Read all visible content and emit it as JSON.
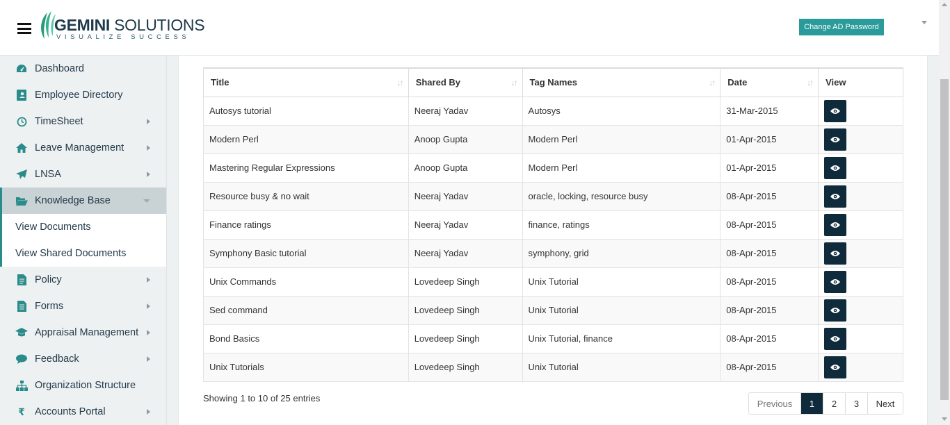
{
  "header": {
    "logo_main_light": "GEMINI",
    "logo_main_second": " SOLUTIONS",
    "logo_tagline": "VISUALIZE SUCCESS",
    "ad_button": "Change AD Password"
  },
  "sidebar": {
    "items": [
      {
        "label": "Dashboard",
        "icon": "dashboard-icon"
      },
      {
        "label": "Employee Directory",
        "icon": "contact-card-icon"
      },
      {
        "label": "TimeSheet",
        "icon": "clock-icon"
      },
      {
        "label": "Leave Management",
        "icon": "home-icon"
      },
      {
        "label": "LNSA",
        "icon": "paper-plane-icon"
      },
      {
        "label": "Knowledge Base",
        "icon": "folder-open-icon"
      },
      {
        "label": "Policy",
        "icon": "document-icon"
      },
      {
        "label": "Forms",
        "icon": "form-icon"
      },
      {
        "label": "Appraisal Management",
        "icon": "graduation-cap-icon"
      },
      {
        "label": "Feedback",
        "icon": "comments-icon"
      },
      {
        "label": "Organization Structure",
        "icon": "sitemap-icon"
      },
      {
        "label": "Accounts Portal",
        "icon": "rupee-icon"
      }
    ],
    "subitems": [
      {
        "label": "View Documents"
      },
      {
        "label": "View Shared Documents"
      }
    ]
  },
  "table": {
    "columns": [
      "Title",
      "Shared By",
      "Tag Names",
      "Date",
      "View"
    ],
    "rows": [
      [
        "Autosys tutorial",
        "Neeraj Yadav",
        "Autosys",
        "31-Mar-2015"
      ],
      [
        "Modern Perl",
        "Anoop Gupta",
        "Modern Perl",
        "01-Apr-2015"
      ],
      [
        "Mastering Regular Expressions",
        "Anoop Gupta",
        "Modern Perl",
        "01-Apr-2015"
      ],
      [
        "Resource busy & no wait",
        "Neeraj Yadav",
        "oracle, locking, resource busy",
        "08-Apr-2015"
      ],
      [
        "Finance ratings",
        "Neeraj Yadav",
        "finance, ratings",
        "08-Apr-2015"
      ],
      [
        "Symphony Basic tutorial",
        "Neeraj Yadav",
        "symphony, grid",
        "08-Apr-2015"
      ],
      [
        "Unix Commands",
        "Lovedeep Singh",
        "Unix Tutorial",
        "08-Apr-2015"
      ],
      [
        "Sed command",
        "Lovedeep Singh",
        "Unix Tutorial",
        "08-Apr-2015"
      ],
      [
        "Bond Basics",
        "Lovedeep Singh",
        "Unix Tutorial, finance",
        "08-Apr-2015"
      ],
      [
        "Unix Tutorials",
        "Lovedeep Singh",
        "Unix Tutorial",
        "08-Apr-2015"
      ]
    ]
  },
  "info": "Showing 1 to 10 of 25 entries",
  "pagination": {
    "previous": "Previous",
    "pages": [
      "1",
      "2",
      "3"
    ],
    "current": "1",
    "next": "Next"
  },
  "colors": {
    "accent": "#2a9a9a",
    "dark": "#0f2a3a"
  }
}
